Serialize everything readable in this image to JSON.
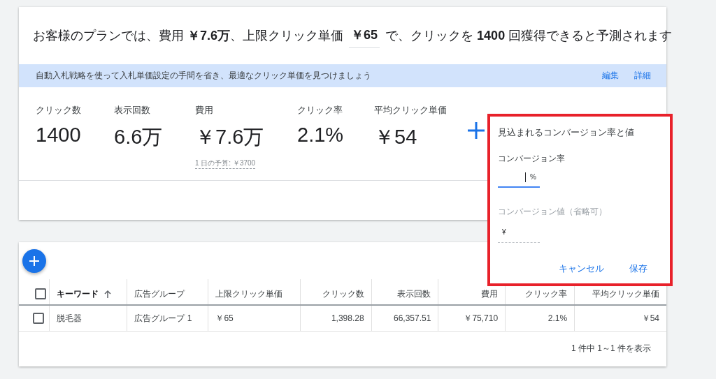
{
  "headline": {
    "before": "お客様のプランでは、費用 **￥7.6万**、上限クリック単価",
    "bid_value": "￥65",
    "after": "で、クリックを **1400** 回獲得できると予測されます"
  },
  "banner": {
    "text": "自動入札戦略を使って入札単価設定の手間を省き、最適なクリック単価を見つけましょう",
    "links": [
      "編集",
      "詳細"
    ]
  },
  "stats": [
    {
      "label": "クリック数",
      "value": "1400"
    },
    {
      "label": "表示回数",
      "value": "6.6万"
    },
    {
      "label": "費用",
      "value": "￥7.6万",
      "note": "1 日の予算: ￥3700"
    },
    {
      "label": "クリック率",
      "value": "2.1%"
    },
    {
      "label": "平均クリック単価",
      "value": "￥54"
    }
  ],
  "popup": {
    "title": "見込まれるコンバージョン率と値",
    "rate_field": {
      "label": "コンバージョン率",
      "suffix": "%"
    },
    "value_field": {
      "label": "コンバージョン値（省略可）",
      "prefix": "¥"
    },
    "buttons": [
      "キャンセル",
      "保存"
    ]
  },
  "table": {
    "header_checked": false,
    "columns": [
      {
        "label": "キーワード",
        "sorted": true
      },
      {
        "label": "広告グループ",
        "sorted": false
      },
      {
        "label": "上限クリック単価",
        "sorted": false
      },
      {
        "label": "クリック数",
        "sorted": false
      },
      {
        "label": "表示回数",
        "sorted": false
      },
      {
        "label": "費用",
        "sorted": false
      },
      {
        "label": "クリック率",
        "sorted": false
      },
      {
        "label": "平均クリック単価",
        "sorted": false
      }
    ],
    "rows": [
      {
        "checked": false,
        "cells": [
          "脱毛器",
          "広告グループ 1",
          "￥65",
          "1,398.28",
          "66,357.51",
          "￥75,710",
          "2.1%",
          "￥54"
        ]
      }
    ],
    "footer": "1 件中 1～1 件を表示"
  }
}
